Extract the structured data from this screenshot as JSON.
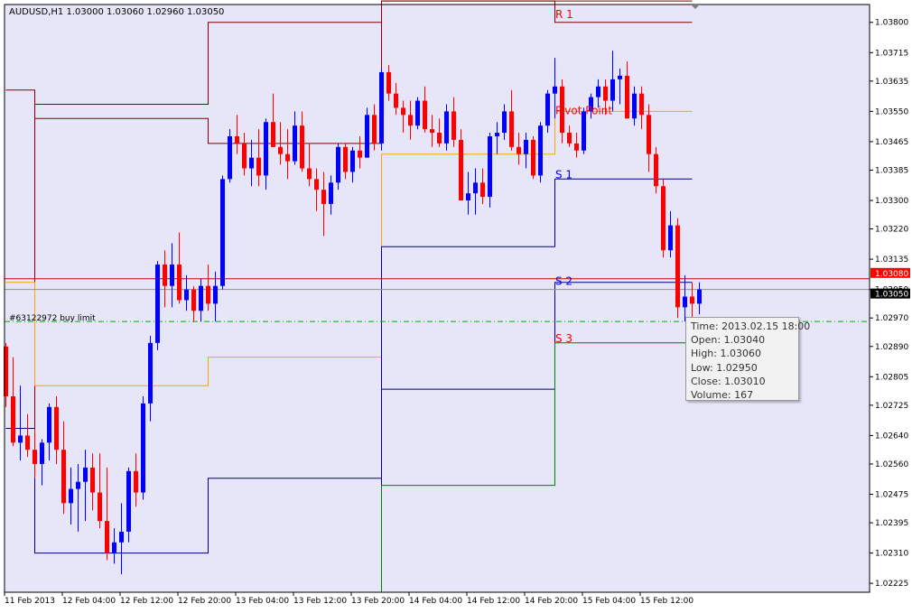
{
  "header": {
    "symbol_text": "AUDUSD,H1  1.03000 1.03060 1.02960 1.03050"
  },
  "order_label": "#63122972 buy limit",
  "colors": {
    "background": "#e6e6f8",
    "bull": "#0000ff",
    "bear": "#ff0000",
    "r1": "#800000",
    "pivot": "#ffa500",
    "s1": "#000080",
    "s2": "#000080",
    "s3": "#008000",
    "order_line": "#00b000"
  },
  "tooltip": {
    "time": "Time: 2013.02.15 18:00",
    "open": "Open: 1.03040",
    "high": "High: 1.03060",
    "low": "Low:  1.02950",
    "close": "Close: 1.03010",
    "volume": "Volume: 167"
  },
  "chart_data": {
    "type": "candlestick",
    "symbol": "AUDUSD",
    "timeframe": "H1",
    "ylim": [
      1.022,
      1.0385
    ],
    "y_ticks": [
      "1.03800",
      "1.03715",
      "1.03635",
      "1.03550",
      "1.03465",
      "1.03385",
      "1.03300",
      "1.03220",
      "1.03135",
      "1.03050",
      "1.02970",
      "1.02890",
      "1.02805",
      "1.02725",
      "1.02640",
      "1.02560",
      "1.02475",
      "1.02395",
      "1.02310",
      "1.02225"
    ],
    "x_ticks": [
      "11 Feb 2013",
      "12 Feb 04:00",
      "12 Feb 12:00",
      "12 Feb 20:00",
      "13 Feb 04:00",
      "13 Feb 12:00",
      "13 Feb 20:00",
      "14 Feb 04:00",
      "14 Feb 12:00",
      "14 Feb 20:00",
      "15 Feb 04:00",
      "15 Feb 12:00"
    ],
    "price_labels": [
      {
        "text": "1.03080",
        "value": 1.0308,
        "color": "#ff0000"
      },
      {
        "text": "1.03050",
        "value": 1.0305,
        "color": "#000000"
      }
    ],
    "level_names": {
      "r1": "R 1",
      "pivot": "Pivot Point",
      "s1": "S 1",
      "s2": "S 2",
      "s3": "S 3"
    },
    "levels": {
      "r1": [
        [
          0,
          1.0266
        ],
        [
          4,
          1.0266
        ],
        [
          4,
          1.0357
        ],
        [
          28,
          1.0357
        ],
        [
          28,
          1.038
        ],
        [
          52,
          1.038
        ],
        [
          52,
          1.0386
        ],
        [
          76,
          1.0386
        ],
        [
          76,
          1.038
        ],
        [
          95,
          1.038
        ]
      ],
      "level2": [
        [
          0,
          1.0361
        ],
        [
          4,
          1.0361
        ],
        [
          4,
          1.0353
        ],
        [
          28,
          1.0353
        ],
        [
          28,
          1.0346
        ],
        [
          52,
          1.0346
        ],
        [
          52,
          1.0386
        ],
        [
          95,
          1.0386
        ]
      ],
      "pivot": [
        [
          0,
          1.0307
        ],
        [
          4,
          1.0307
        ],
        [
          4,
          1.0278
        ],
        [
          28,
          1.0278
        ],
        [
          28,
          1.0286
        ],
        [
          52,
          1.0286
        ],
        [
          52,
          1.0343
        ],
        [
          76,
          1.0343
        ],
        [
          76,
          1.0355
        ],
        [
          95,
          1.0355
        ]
      ],
      "s1": [
        [
          0,
          1.0266
        ],
        [
          4,
          1.0266
        ],
        [
          4,
          1.0231
        ],
        [
          28,
          1.0231
        ],
        [
          28,
          1.0252
        ],
        [
          52,
          1.0252
        ],
        [
          52,
          1.0317
        ],
        [
          76,
          1.0317
        ],
        [
          76,
          1.0336
        ],
        [
          95,
          1.0336
        ]
      ],
      "s2": [
        [
          52,
          1.0225
        ],
        [
          52,
          1.0277
        ],
        [
          76,
          1.0277
        ],
        [
          76,
          1.0307
        ],
        [
          95,
          1.0307
        ]
      ],
      "s3": [
        [
          52,
          1.022
        ],
        [
          52,
          1.025
        ],
        [
          76,
          1.025
        ],
        [
          76,
          1.029
        ],
        [
          95,
          1.029
        ]
      ]
    },
    "order_level": 1.0296,
    "candles": [
      [
        1.0289,
        1.029,
        1.0272,
        1.0275
      ],
      [
        1.0275,
        1.0286,
        1.0261,
        1.0262
      ],
      [
        1.0262,
        1.0278,
        1.0257,
        1.0264
      ],
      [
        1.0264,
        1.027,
        1.0258,
        1.026
      ],
      [
        1.026,
        1.0266,
        1.0252,
        1.0256
      ],
      [
        1.0256,
        1.0263,
        1.025,
        1.0262
      ],
      [
        1.0262,
        1.0273,
        1.0257,
        1.0272
      ],
      [
        1.0272,
        1.0275,
        1.0256,
        1.026
      ],
      [
        1.026,
        1.0268,
        1.0242,
        1.0245
      ],
      [
        1.0245,
        1.0255,
        1.0239,
        1.0249
      ],
      [
        1.0249,
        1.0256,
        1.0237,
        1.0251
      ],
      [
        1.0251,
        1.026,
        1.024,
        1.0255
      ],
      [
        1.0255,
        1.0259,
        1.0243,
        1.0248
      ],
      [
        1.0248,
        1.0259,
        1.0238,
        1.024
      ],
      [
        1.024,
        1.0255,
        1.0229,
        1.0231
      ],
      [
        1.0231,
        1.0238,
        1.0228,
        1.0234
      ],
      [
        1.0234,
        1.0245,
        1.0225,
        1.0237
      ],
      [
        1.0237,
        1.0255,
        1.0234,
        1.0254
      ],
      [
        1.0254,
        1.0259,
        1.0244,
        1.0248
      ],
      [
        1.0248,
        1.0275,
        1.0246,
        1.0273
      ],
      [
        1.0273,
        1.0292,
        1.0268,
        1.029
      ],
      [
        1.029,
        1.0313,
        1.0288,
        1.0312
      ],
      [
        1.0312,
        1.0316,
        1.03,
        1.0306
      ],
      [
        1.0306,
        1.0318,
        1.03,
        1.0312
      ],
      [
        1.0312,
        1.0321,
        1.0301,
        1.0302
      ],
      [
        1.0302,
        1.0309,
        1.0299,
        1.0305
      ],
      [
        1.0305,
        1.0306,
        1.0296,
        1.0299
      ],
      [
        1.0299,
        1.0308,
        1.0296,
        1.0306
      ],
      [
        1.0306,
        1.0312,
        1.0299,
        1.0301
      ],
      [
        1.0301,
        1.031,
        1.0296,
        1.0306
      ],
      [
        1.0306,
        1.0337,
        1.0305,
        1.0336
      ],
      [
        1.0336,
        1.035,
        1.0335,
        1.0348
      ],
      [
        1.0348,
        1.0354,
        1.0343,
        1.0346
      ],
      [
        1.0346,
        1.0349,
        1.0337,
        1.0339
      ],
      [
        1.0339,
        1.0347,
        1.0334,
        1.0342
      ],
      [
        1.0342,
        1.035,
        1.0334,
        1.0337
      ],
      [
        1.0337,
        1.0353,
        1.0333,
        1.0352
      ],
      [
        1.0352,
        1.036,
        1.0345,
        1.0345
      ],
      [
        1.0345,
        1.0352,
        1.034,
        1.0343
      ],
      [
        1.0343,
        1.035,
        1.0336,
        1.0341
      ],
      [
        1.0341,
        1.0355,
        1.034,
        1.0351
      ],
      [
        1.0351,
        1.0355,
        1.0338,
        1.0339
      ],
      [
        1.0339,
        1.0346,
        1.0334,
        1.0336
      ],
      [
        1.0336,
        1.0339,
        1.0327,
        1.0333
      ],
      [
        1.0333,
        1.0338,
        1.032,
        1.0329
      ],
      [
        1.0329,
        1.0337,
        1.0326,
        1.0335
      ],
      [
        1.0335,
        1.0346,
        1.0333,
        1.0345
      ],
      [
        1.0345,
        1.0346,
        1.0336,
        1.0338
      ],
      [
        1.0338,
        1.0345,
        1.0335,
        1.0344
      ],
      [
        1.0344,
        1.0348,
        1.0339,
        1.0342
      ],
      [
        1.0342,
        1.0356,
        1.0342,
        1.0354
      ],
      [
        1.0354,
        1.0357,
        1.0344,
        1.0346
      ],
      [
        1.0346,
        1.0367,
        1.0344,
        1.0366
      ],
      [
        1.0366,
        1.0368,
        1.0358,
        1.036
      ],
      [
        1.036,
        1.0363,
        1.0354,
        1.0356
      ],
      [
        1.0356,
        1.0358,
        1.0349,
        1.0354
      ],
      [
        1.0354,
        1.0358,
        1.0347,
        1.0351
      ],
      [
        1.0351,
        1.0359,
        1.035,
        1.0358
      ],
      [
        1.0358,
        1.0362,
        1.0349,
        1.035
      ],
      [
        1.035,
        1.0354,
        1.0345,
        1.0349
      ],
      [
        1.0349,
        1.0353,
        1.0345,
        1.0346
      ],
      [
        1.0346,
        1.0357,
        1.0344,
        1.0355
      ],
      [
        1.0355,
        1.0359,
        1.0345,
        1.0347
      ],
      [
        1.0347,
        1.035,
        1.033,
        1.033
      ],
      [
        1.033,
        1.0338,
        1.0326,
        1.0332
      ],
      [
        1.0332,
        1.0339,
        1.0326,
        1.0335
      ],
      [
        1.0335,
        1.0339,
        1.0329,
        1.0331
      ],
      [
        1.0331,
        1.0349,
        1.0328,
        1.0348
      ],
      [
        1.0348,
        1.0352,
        1.0343,
        1.0349
      ],
      [
        1.0349,
        1.0357,
        1.0347,
        1.0355
      ],
      [
        1.0355,
        1.0361,
        1.0344,
        1.0345
      ],
      [
        1.0345,
        1.0349,
        1.034,
        1.0343
      ],
      [
        1.0343,
        1.0349,
        1.0339,
        1.0347
      ],
      [
        1.0347,
        1.0348,
        1.0336,
        1.0337
      ],
      [
        1.0337,
        1.0352,
        1.0335,
        1.0351
      ],
      [
        1.0351,
        1.0361,
        1.0349,
        1.036
      ],
      [
        1.036,
        1.037,
        1.0353,
        1.0362
      ],
      [
        1.0362,
        1.0364,
        1.0346,
        1.0349
      ],
      [
        1.0349,
        1.0351,
        1.0345,
        1.0346
      ],
      [
        1.0346,
        1.0349,
        1.0342,
        1.0344
      ],
      [
        1.0344,
        1.0356,
        1.0343,
        1.0355
      ],
      [
        1.0355,
        1.036,
        1.0353,
        1.0359
      ],
      [
        1.0359,
        1.0364,
        1.0356,
        1.0362
      ],
      [
        1.0362,
        1.0364,
        1.0354,
        1.0358
      ],
      [
        1.0358,
        1.0372,
        1.0355,
        1.0364
      ],
      [
        1.0364,
        1.0367,
        1.0357,
        1.0365
      ],
      [
        1.0365,
        1.0369,
        1.0353,
        1.0353
      ],
      [
        1.0353,
        1.0362,
        1.0351,
        1.036
      ],
      [
        1.036,
        1.0362,
        1.035,
        1.0354
      ],
      [
        1.0354,
        1.0357,
        1.0338,
        1.0343
      ],
      [
        1.0343,
        1.0345,
        1.0332,
        1.0334
      ],
      [
        1.0334,
        1.0336,
        1.0314,
        1.0316
      ],
      [
        1.0316,
        1.0327,
        1.0314,
        1.0323
      ],
      [
        1.0323,
        1.0325,
        1.0297,
        1.03
      ],
      [
        1.03,
        1.0309,
        1.0296,
        1.0303
      ],
      [
        1.0303,
        1.0307,
        1.0295,
        1.0301
      ],
      [
        1.0301,
        1.0307,
        1.0298,
        1.0305
      ]
    ]
  }
}
